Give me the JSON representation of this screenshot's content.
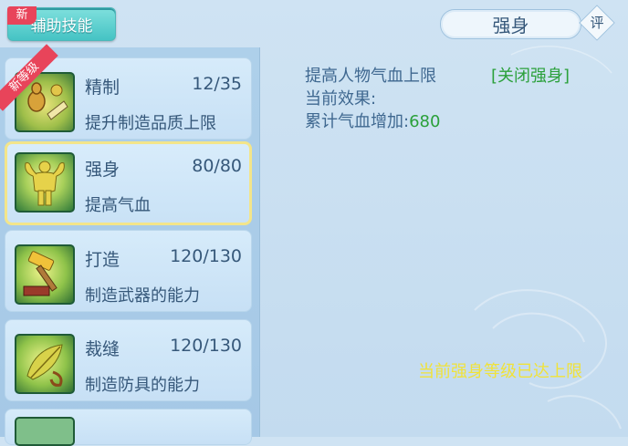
{
  "header": {
    "tab_label": "辅助技能",
    "new_tag": "新",
    "detail_title": "强身",
    "review_button": "评"
  },
  "skills": [
    {
      "name": "精制",
      "level": "12/35",
      "desc": "提升制造品质上限",
      "ribbon": "新等级",
      "icon": "gourd-herbs-icon"
    },
    {
      "name": "强身",
      "level": "80/80",
      "desc": "提高气血",
      "icon": "muscle-man-icon",
      "selected": true
    },
    {
      "name": "打造",
      "level": "120/130",
      "desc": "制造武器的能力",
      "icon": "hammer-icon"
    },
    {
      "name": "裁缝",
      "level": "120/130",
      "desc": "制造防具的能力",
      "icon": "leaf-needle-icon"
    }
  ],
  "detail": {
    "line1": "提高人物气血上限",
    "toggle_link": "[关闭强身]",
    "line2": "当前效果:",
    "line3_label": "累计气血增加:",
    "line3_value": "680",
    "max_notice": "当前强身等级已达上限"
  },
  "colors": {
    "accent_teal": "#45c3c4",
    "tag_red": "#e8445a",
    "text_blue": "#36587a",
    "value_green": "#2aa03a",
    "notice_yellow": "#f0e23a",
    "selected_border": "#f3e58a"
  }
}
